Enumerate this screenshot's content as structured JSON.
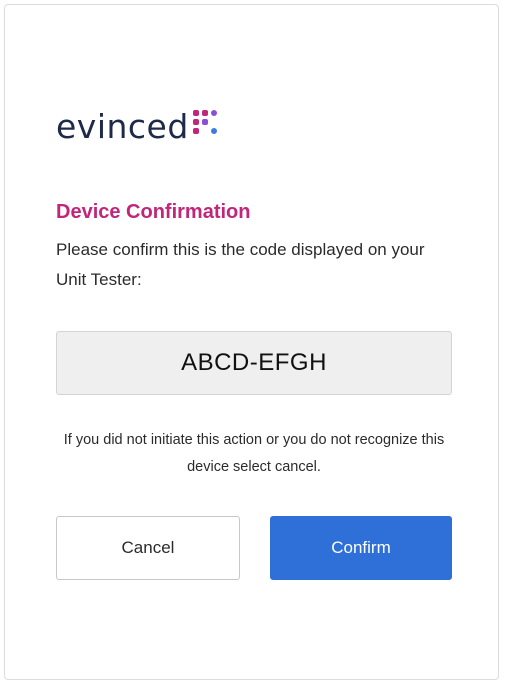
{
  "brand": {
    "logo_text": "evinced",
    "logo_icon": "evinced-dots-icon",
    "colors": {
      "text": "#1e2a4a",
      "dot_magenta": "#c0267a",
      "dot_purple": "#8a4fd8",
      "dot_blue": "#3d7be0"
    }
  },
  "dialog": {
    "title": "Device Confirmation",
    "prompt": "Please confirm this is the code displayed on your Unit Tester:",
    "code": "ABCD-EFGH",
    "notice": "If you did not initiate this action or you do not recognize this device select cancel."
  },
  "actions": {
    "cancel_label": "Cancel",
    "confirm_label": "Confirm"
  },
  "colors": {
    "title": "#c0267a",
    "primary": "#2f6fd8"
  }
}
